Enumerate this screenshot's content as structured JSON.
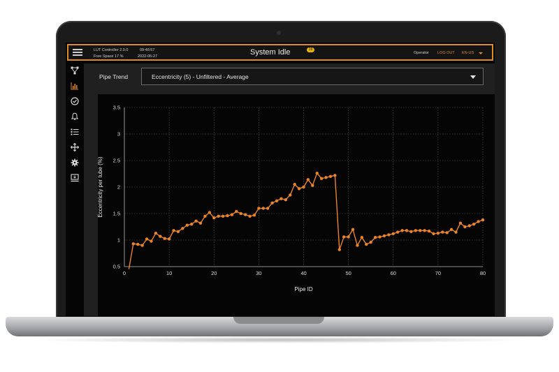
{
  "header": {
    "app_version": "LUT Controller 2.0.0",
    "free_space": "Free Space 17 %",
    "time": "09:46:57",
    "date": "2022-05-27",
    "title": "System Idle",
    "badge": "19",
    "user": "Operator",
    "logout_label": "LOG OUT",
    "language": "EN-US"
  },
  "sidebar": {
    "items": [
      {
        "icon": "network-icon",
        "active": false
      },
      {
        "icon": "bar-chart-icon",
        "active": true
      },
      {
        "icon": "check-circle-icon",
        "active": false
      },
      {
        "icon": "bell-icon",
        "active": false
      },
      {
        "icon": "list-icon",
        "active": false
      },
      {
        "icon": "move-icon",
        "active": false
      },
      {
        "icon": "gear-icon",
        "active": false
      },
      {
        "icon": "monitor-icon",
        "active": false
      }
    ]
  },
  "trend": {
    "label": "Pipe Trend",
    "selected": "Eccentricity (5) - Unfiltered - Average"
  },
  "colors": {
    "accent": "#e08a22",
    "line": "#e8832a",
    "grid": "#5a5a5a"
  },
  "chart_data": {
    "type": "line",
    "xlabel": "Pipe ID",
    "ylabel": "Eccentricity per tube (%)",
    "xlim": [
      0,
      80
    ],
    "ylim": [
      0.5,
      3.5
    ],
    "xticks": [
      0,
      10,
      20,
      30,
      40,
      50,
      60,
      70,
      80
    ],
    "yticks": [
      0.5,
      1,
      1.5,
      2,
      2.5,
      3,
      3.5
    ],
    "grid": true,
    "series": [
      {
        "x": [
          1,
          2,
          3,
          4,
          5,
          6,
          7,
          8,
          9,
          10,
          11,
          12,
          13,
          14,
          15,
          16,
          17,
          18,
          19,
          20,
          21,
          22,
          23,
          24,
          25,
          26,
          27,
          28,
          29,
          30,
          31,
          32,
          33,
          34,
          35,
          36,
          37,
          38,
          39,
          40,
          41,
          42,
          43,
          44,
          45,
          46,
          47,
          48,
          49,
          50,
          51,
          52,
          53,
          54,
          55,
          56,
          57,
          58,
          59,
          60,
          61,
          62,
          63,
          64,
          65,
          66,
          67,
          68,
          69,
          70,
          71,
          72,
          73,
          74,
          75,
          76,
          77,
          78,
          79,
          80
        ],
        "y": [
          0.45,
          0.93,
          0.92,
          0.9,
          1.02,
          0.98,
          1.13,
          1.07,
          1.03,
          1.02,
          1.18,
          1.16,
          1.22,
          1.28,
          1.3,
          1.36,
          1.32,
          1.45,
          1.52,
          1.42,
          1.45,
          1.45,
          1.46,
          1.48,
          1.54,
          1.5,
          1.48,
          1.45,
          1.47,
          1.6,
          1.6,
          1.6,
          1.7,
          1.74,
          1.78,
          1.76,
          1.85,
          2.05,
          1.97,
          2.0,
          2.14,
          2.03,
          2.26,
          2.16,
          2.18,
          2.2,
          2.22,
          0.82,
          1.06,
          1.06,
          1.2,
          0.9,
          1.05,
          0.92,
          0.96,
          1.05,
          1.06,
          1.08,
          1.1,
          1.12,
          1.15,
          1.18,
          1.18,
          1.16,
          1.18,
          1.18,
          1.18,
          1.17,
          1.12,
          1.13,
          1.15,
          1.14,
          1.2,
          1.15,
          1.32,
          1.25,
          1.27,
          1.3,
          1.35,
          1.38
        ]
      }
    ]
  }
}
